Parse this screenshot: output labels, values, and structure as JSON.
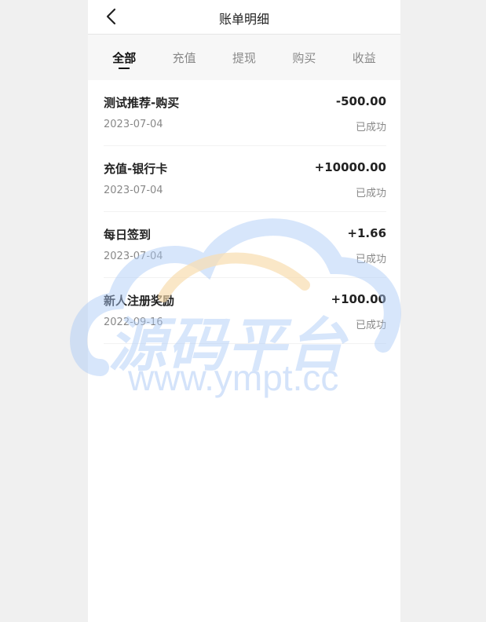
{
  "header": {
    "title": "账单明细",
    "back_icon": "chevron-left-icon"
  },
  "tabs": [
    {
      "label": "全部",
      "active": true
    },
    {
      "label": "充值",
      "active": false
    },
    {
      "label": "提现",
      "active": false
    },
    {
      "label": "购买",
      "active": false
    },
    {
      "label": "收益",
      "active": false
    }
  ],
  "records": [
    {
      "name": "测试推荐-购买",
      "amount": "-500.00",
      "date": "2023-07-04",
      "status": "已成功"
    },
    {
      "name": "充值-银行卡",
      "amount": "+10000.00",
      "date": "2023-07-04",
      "status": "已成功"
    },
    {
      "name": "每日签到",
      "amount": "+1.66",
      "date": "2023-07-04",
      "status": "已成功"
    },
    {
      "name": "新人注册奖励",
      "amount": "+100.00",
      "date": "2022-09-16",
      "status": "已成功"
    }
  ],
  "watermark": {
    "text": "源码平台",
    "url": "www.ympt.cc"
  },
  "colors": {
    "background": "#f0f0f0",
    "panel": "#ffffff",
    "tab_bar": "#f7f7f7",
    "text_primary": "#222222",
    "text_secondary": "#888888",
    "watermark_blue": "#aac8f5",
    "watermark_orange": "#f7d9a8"
  }
}
